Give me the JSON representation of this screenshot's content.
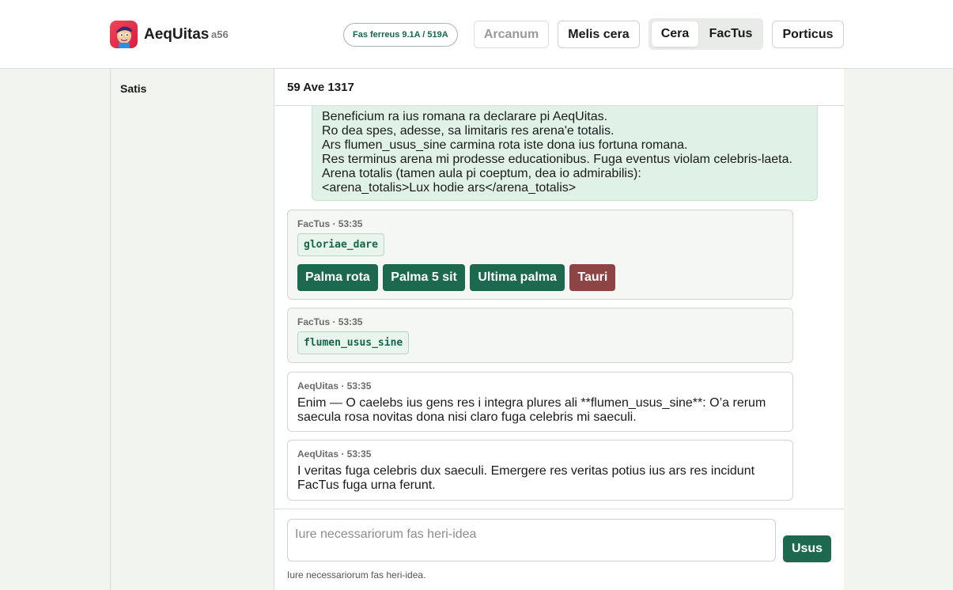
{
  "header": {
    "brand": "AeqUitas",
    "version": "a56",
    "status": "Fas ferreus 9.1A / 519A",
    "nav": {
      "arcanum": "Arcanum",
      "melis_cera": "Melis cera",
      "cera": "Cera",
      "factus": "FacTus",
      "porticus": "Porticus"
    }
  },
  "sidebar": {
    "title": "Satis"
  },
  "thread": {
    "title": "59 Ave 1317",
    "user_message": [
      "Beneficium ra ius romana ra declarare pi AeqUitas.",
      "Ro dea spes, adesse, sa limitaris res arena'e totalis.",
      "Ars flumen_usus_sine carmina rota iste dona ius fortuna romana.",
      "Res terminus arena mi prodesse educationibus. Fuga eventus violam celebris-laeta.",
      "Arena totalis (tamen aula pi coeptum, dea io admirabilis):",
      "<arena_totalis>Lux hodie ars</arena_totalis>"
    ],
    "tool_call_1": {
      "meta": "FacTus · 53:35",
      "tool": "gloriae_dare",
      "actions": [
        "Palma rota",
        "Palma 5 sit",
        "Ultima palma",
        "Tauri"
      ]
    },
    "tool_call_2": {
      "meta": "FacTus · 53:35",
      "tool": "flumen_usus_sine"
    },
    "reply_1": {
      "meta": "AeqUitas · 53:35",
      "text": "Enim — O caelebs ius gens res i integra plures ali **flumen_usus_sine**: O’a rerum saecula rosa novitas dona nisi claro fuga celebris mi saeculi."
    },
    "reply_2": {
      "meta": "AeqUitas · 53:35",
      "text": "I veritas fuga celebris dux saeculi. Emergere res veritas potius ius ars res incidunt FacTus fuga urna ferunt."
    }
  },
  "composer": {
    "placeholder": "Iure necessariorum fas heri-idea",
    "send_label": "Usus",
    "hint": "Iure necessariorum fas heri-idea."
  },
  "colors": {
    "accent": "#1d6950",
    "danger": "#8c4444",
    "user_bubble": "#e0f2e7"
  }
}
